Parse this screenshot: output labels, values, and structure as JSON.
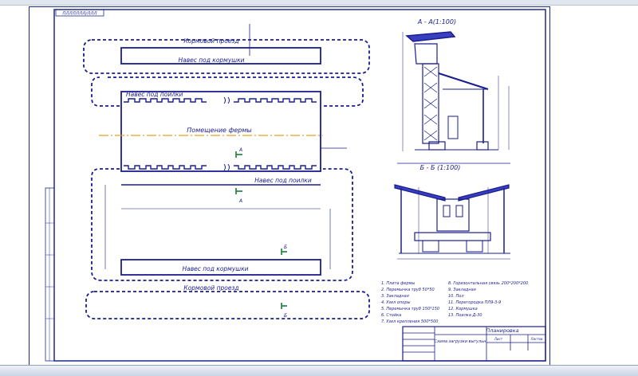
{
  "sheet": {
    "stamp_code": "ПЛЛЛЛЛЛ/ЛЛЛ",
    "plan": {
      "feed_drive_top": "Кормовой проезд",
      "feed_drive_bottom": "Кормовой проезд",
      "trough_canopy_top": "Навес под кормушки",
      "trough_canopy_bottom": "Навес под кормушки",
      "drinker_canopy_top": "Навес под поилки",
      "drinker_canopy_bottom": "Навес под поилки",
      "farm_room": "Помещение фермы",
      "mark_a": "А",
      "mark_b": "Б"
    },
    "section_aa_title": "А - А(1:100)",
    "section_bb_title": "Б - Б (1:100)",
    "legend": [
      "1. Плита фермы",
      "2. Перемычка труб 50*50",
      "3. Закладная",
      "4. Узел опоры",
      "5. Перемычка труб 150*150",
      "6. Стойка",
      "7. Узел крепления 500*500",
      "8. Горизонтальная связь 200*200*200",
      "9. Закладная",
      "10. Пол",
      "11. Перегородка ПЛ9-3-9",
      "12. Кормушка",
      "13. Поилка Д-30"
    ],
    "title_block": {
      "doc_title": "Планировка",
      "sheet_name": "Схема загрузки выгульн",
      "sheet_label": "Лист",
      "sheets_label": "Листов"
    }
  }
}
